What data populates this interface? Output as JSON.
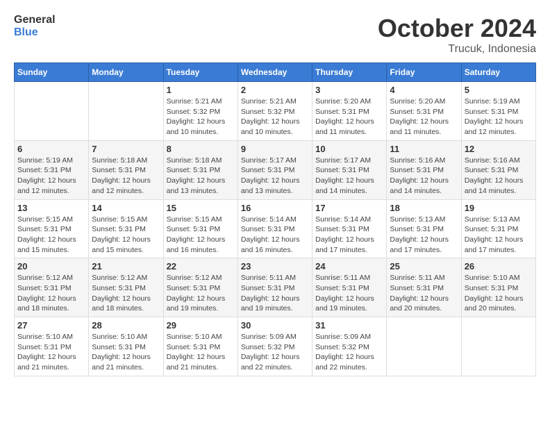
{
  "logo": {
    "text_general": "General",
    "text_blue": "Blue"
  },
  "header": {
    "month": "October 2024",
    "location": "Trucuk, Indonesia"
  },
  "weekdays": [
    "Sunday",
    "Monday",
    "Tuesday",
    "Wednesday",
    "Thursday",
    "Friday",
    "Saturday"
  ],
  "weeks": [
    [
      {
        "day": "",
        "info": ""
      },
      {
        "day": "",
        "info": ""
      },
      {
        "day": "1",
        "info": "Sunrise: 5:21 AM\nSunset: 5:32 PM\nDaylight: 12 hours\nand 10 minutes."
      },
      {
        "day": "2",
        "info": "Sunrise: 5:21 AM\nSunset: 5:32 PM\nDaylight: 12 hours\nand 10 minutes."
      },
      {
        "day": "3",
        "info": "Sunrise: 5:20 AM\nSunset: 5:31 PM\nDaylight: 12 hours\nand 11 minutes."
      },
      {
        "day": "4",
        "info": "Sunrise: 5:20 AM\nSunset: 5:31 PM\nDaylight: 12 hours\nand 11 minutes."
      },
      {
        "day": "5",
        "info": "Sunrise: 5:19 AM\nSunset: 5:31 PM\nDaylight: 12 hours\nand 12 minutes."
      }
    ],
    [
      {
        "day": "6",
        "info": "Sunrise: 5:19 AM\nSunset: 5:31 PM\nDaylight: 12 hours\nand 12 minutes."
      },
      {
        "day": "7",
        "info": "Sunrise: 5:18 AM\nSunset: 5:31 PM\nDaylight: 12 hours\nand 12 minutes."
      },
      {
        "day": "8",
        "info": "Sunrise: 5:18 AM\nSunset: 5:31 PM\nDaylight: 12 hours\nand 13 minutes."
      },
      {
        "day": "9",
        "info": "Sunrise: 5:17 AM\nSunset: 5:31 PM\nDaylight: 12 hours\nand 13 minutes."
      },
      {
        "day": "10",
        "info": "Sunrise: 5:17 AM\nSunset: 5:31 PM\nDaylight: 12 hours\nand 14 minutes."
      },
      {
        "day": "11",
        "info": "Sunrise: 5:16 AM\nSunset: 5:31 PM\nDaylight: 12 hours\nand 14 minutes."
      },
      {
        "day": "12",
        "info": "Sunrise: 5:16 AM\nSunset: 5:31 PM\nDaylight: 12 hours\nand 14 minutes."
      }
    ],
    [
      {
        "day": "13",
        "info": "Sunrise: 5:15 AM\nSunset: 5:31 PM\nDaylight: 12 hours\nand 15 minutes."
      },
      {
        "day": "14",
        "info": "Sunrise: 5:15 AM\nSunset: 5:31 PM\nDaylight: 12 hours\nand 15 minutes."
      },
      {
        "day": "15",
        "info": "Sunrise: 5:15 AM\nSunset: 5:31 PM\nDaylight: 12 hours\nand 16 minutes."
      },
      {
        "day": "16",
        "info": "Sunrise: 5:14 AM\nSunset: 5:31 PM\nDaylight: 12 hours\nand 16 minutes."
      },
      {
        "day": "17",
        "info": "Sunrise: 5:14 AM\nSunset: 5:31 PM\nDaylight: 12 hours\nand 17 minutes."
      },
      {
        "day": "18",
        "info": "Sunrise: 5:13 AM\nSunset: 5:31 PM\nDaylight: 12 hours\nand 17 minutes."
      },
      {
        "day": "19",
        "info": "Sunrise: 5:13 AM\nSunset: 5:31 PM\nDaylight: 12 hours\nand 17 minutes."
      }
    ],
    [
      {
        "day": "20",
        "info": "Sunrise: 5:12 AM\nSunset: 5:31 PM\nDaylight: 12 hours\nand 18 minutes."
      },
      {
        "day": "21",
        "info": "Sunrise: 5:12 AM\nSunset: 5:31 PM\nDaylight: 12 hours\nand 18 minutes."
      },
      {
        "day": "22",
        "info": "Sunrise: 5:12 AM\nSunset: 5:31 PM\nDaylight: 12 hours\nand 19 minutes."
      },
      {
        "day": "23",
        "info": "Sunrise: 5:11 AM\nSunset: 5:31 PM\nDaylight: 12 hours\nand 19 minutes."
      },
      {
        "day": "24",
        "info": "Sunrise: 5:11 AM\nSunset: 5:31 PM\nDaylight: 12 hours\nand 19 minutes."
      },
      {
        "day": "25",
        "info": "Sunrise: 5:11 AM\nSunset: 5:31 PM\nDaylight: 12 hours\nand 20 minutes."
      },
      {
        "day": "26",
        "info": "Sunrise: 5:10 AM\nSunset: 5:31 PM\nDaylight: 12 hours\nand 20 minutes."
      }
    ],
    [
      {
        "day": "27",
        "info": "Sunrise: 5:10 AM\nSunset: 5:31 PM\nDaylight: 12 hours\nand 21 minutes."
      },
      {
        "day": "28",
        "info": "Sunrise: 5:10 AM\nSunset: 5:31 PM\nDaylight: 12 hours\nand 21 minutes."
      },
      {
        "day": "29",
        "info": "Sunrise: 5:10 AM\nSunset: 5:31 PM\nDaylight: 12 hours\nand 21 minutes."
      },
      {
        "day": "30",
        "info": "Sunrise: 5:09 AM\nSunset: 5:32 PM\nDaylight: 12 hours\nand 22 minutes."
      },
      {
        "day": "31",
        "info": "Sunrise: 5:09 AM\nSunset: 5:32 PM\nDaylight: 12 hours\nand 22 minutes."
      },
      {
        "day": "",
        "info": ""
      },
      {
        "day": "",
        "info": ""
      }
    ]
  ]
}
